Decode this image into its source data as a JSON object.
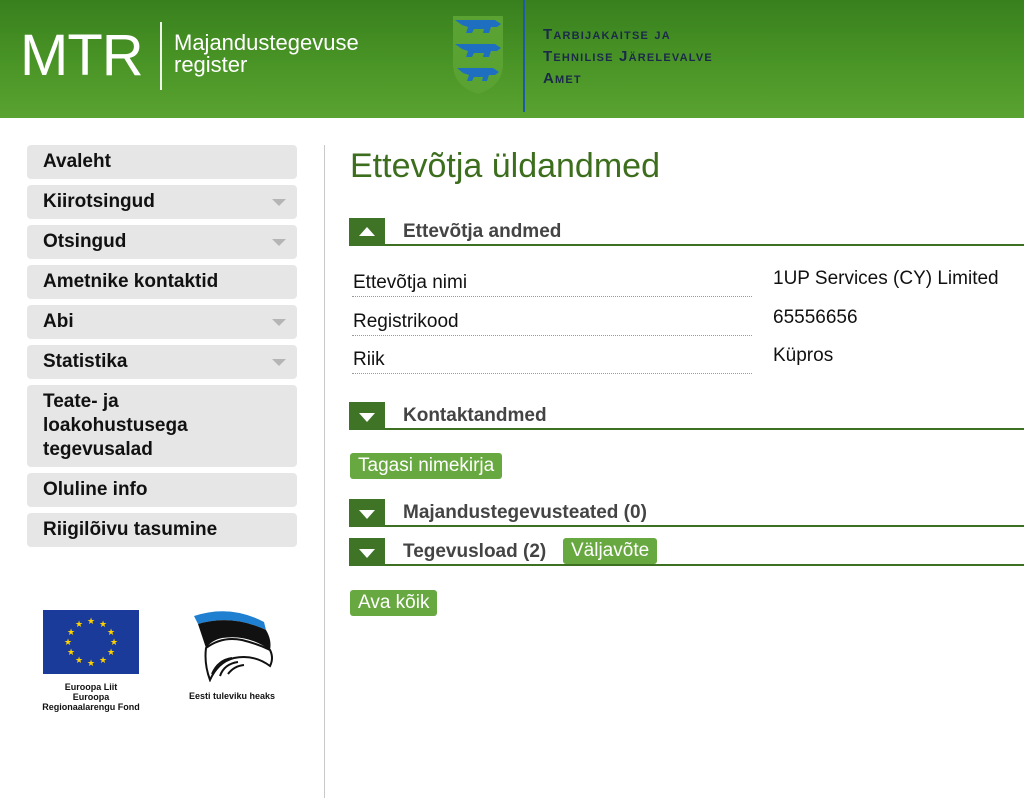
{
  "header": {
    "logo_main": "MTR",
    "logo_sub_line1": "Majandustegevuse",
    "logo_sub_line2": "register",
    "agency_line1": "Tarbijakaitse ja",
    "agency_line2": "Tehnilise Järelevalve",
    "agency_line3": "Amet",
    "crest_icon": "estonian-three-lions-crest-icon"
  },
  "sidebar": {
    "items": [
      {
        "label": "Avaleht",
        "has_dropdown": false
      },
      {
        "label": "Kiirotsingud",
        "has_dropdown": true
      },
      {
        "label": "Otsingud",
        "has_dropdown": true
      },
      {
        "label": "Ametnike kontaktid",
        "has_dropdown": false
      },
      {
        "label": "Abi",
        "has_dropdown": true
      },
      {
        "label": "Statistika",
        "has_dropdown": true
      },
      {
        "label": "Teate- ja loakohustusega tegevusalad",
        "has_dropdown": false
      },
      {
        "label": "Oluline info",
        "has_dropdown": false
      },
      {
        "label": "Riigilõivu tasumine",
        "has_dropdown": false
      }
    ],
    "eu_logo": {
      "line1": "Euroopa Liit",
      "line2": "Euroopa",
      "line3": "Regionaalarengu Fond"
    },
    "ee_logo": {
      "caption": "Eesti tuleviku heaks"
    }
  },
  "main": {
    "title": "Ettevõtja üldandmed",
    "sections": {
      "company": {
        "title": "Ettevõtja andmed",
        "expanded": true
      },
      "contacts": {
        "title": "Kontaktandmed",
        "expanded": false
      },
      "notices": {
        "title": "Majandustegevusteated (0)",
        "expanded": false
      },
      "licences": {
        "title": "Tegevusload (2)",
        "expanded": false
      }
    },
    "fields": [
      {
        "label": "Ettevõtja nimi",
        "value": "1UP Services (CY) Limited"
      },
      {
        "label": "Registrikood",
        "value": "65556656"
      },
      {
        "label": "Riik",
        "value": "Küpros"
      }
    ],
    "buttons": {
      "back_to_list": "Tagasi nimekirja",
      "extract": "Väljavõte",
      "open_all": "Ava kõik"
    }
  },
  "colors": {
    "header_green": "#4a9526",
    "section_green": "#3f7326",
    "button_green": "#68a840",
    "title_green": "#3d6e1e",
    "sidebar_bg": "#e6e6e6"
  }
}
